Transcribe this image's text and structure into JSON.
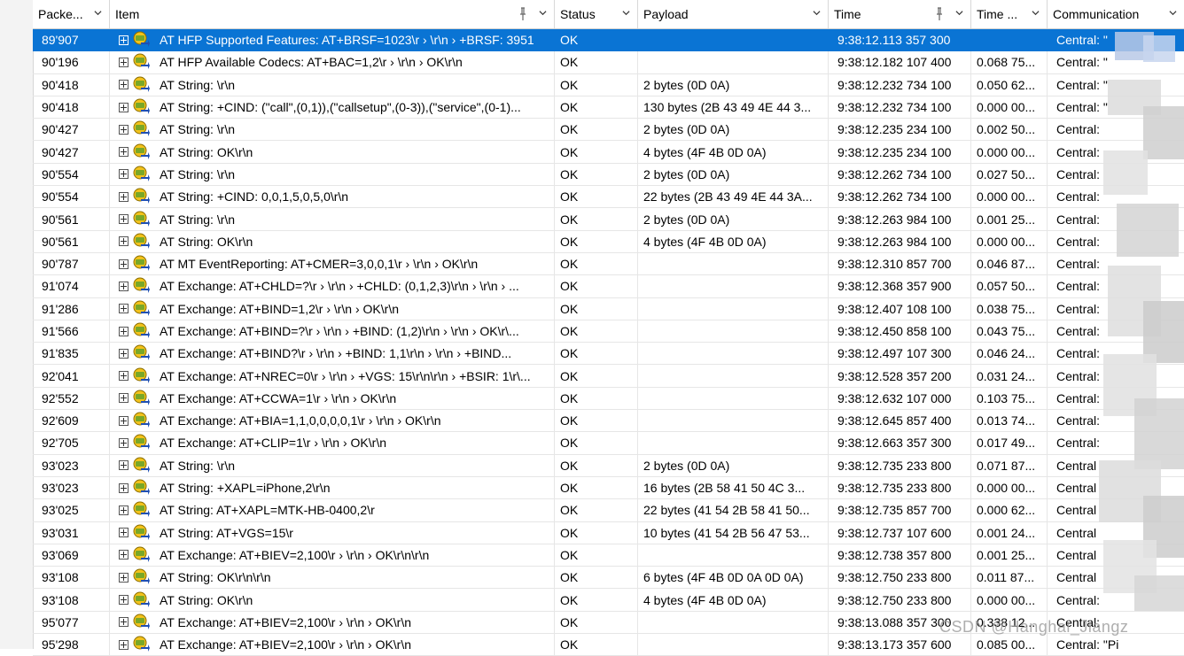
{
  "columns": {
    "packet": "Packe...",
    "item": "Item",
    "status": "Status",
    "payload": "Payload",
    "time": "Time",
    "delta": "Time ...",
    "comm": "Communication"
  },
  "rows": [
    {
      "packet": "89'907",
      "item": "AT HFP Supported Features: AT+BRSF=1023\\r › \\r\\n › +BRSF: 3951",
      "status": "OK",
      "payload": "",
      "time": "9:38:12.113 357 300",
      "delta": "",
      "comm": "Central: \"",
      "selected": true
    },
    {
      "packet": "90'196",
      "item": "AT HFP Available Codecs: AT+BAC=1,2\\r › \\r\\n › OK\\r\\n",
      "status": "OK",
      "payload": "",
      "time": "9:38:12.182 107 400",
      "delta": "0.068 75...",
      "comm": "Central: \""
    },
    {
      "packet": "90'418",
      "item": "AT String: \\r\\n",
      "status": "OK",
      "payload": "2 bytes (0D 0A)",
      "time": "9:38:12.232 734 100",
      "delta": "0.050 62...",
      "comm": "Central: \""
    },
    {
      "packet": "90'418",
      "item": "AT String: +CIND: (\"call\",(0,1)),(\"callsetup\",(0-3)),(\"service\",(0-1)...",
      "status": "OK",
      "payload": "130 bytes (2B 43 49 4E 44 3...",
      "time": "9:38:12.232 734 100",
      "delta": "0.000 00...",
      "comm": "Central: \""
    },
    {
      "packet": "90'427",
      "item": "AT String: \\r\\n",
      "status": "OK",
      "payload": "2 bytes (0D 0A)",
      "time": "9:38:12.235 234 100",
      "delta": "0.002 50...",
      "comm": "Central:"
    },
    {
      "packet": "90'427",
      "item": "AT String: OK\\r\\n",
      "status": "OK",
      "payload": "4 bytes (4F 4B 0D 0A)",
      "time": "9:38:12.235 234 100",
      "delta": "0.000 00...",
      "comm": "Central:"
    },
    {
      "packet": "90'554",
      "item": "AT String: \\r\\n",
      "status": "OK",
      "payload": "2 bytes (0D 0A)",
      "time": "9:38:12.262 734 100",
      "delta": "0.027 50...",
      "comm": "Central:"
    },
    {
      "packet": "90'554",
      "item": "AT String: +CIND: 0,0,1,5,0,5,0\\r\\n",
      "status": "OK",
      "payload": "22 bytes (2B 43 49 4E 44 3A...",
      "time": "9:38:12.262 734 100",
      "delta": "0.000 00...",
      "comm": "Central:"
    },
    {
      "packet": "90'561",
      "item": "AT String: \\r\\n",
      "status": "OK",
      "payload": "2 bytes (0D 0A)",
      "time": "9:38:12.263 984 100",
      "delta": "0.001 25...",
      "comm": "Central:"
    },
    {
      "packet": "90'561",
      "item": "AT String: OK\\r\\n",
      "status": "OK",
      "payload": "4 bytes (4F 4B 0D 0A)",
      "time": "9:38:12.263 984 100",
      "delta": "0.000 00...",
      "comm": "Central:"
    },
    {
      "packet": "90'787",
      "item": "AT MT EventReporting: AT+CMER=3,0,0,1\\r › \\r\\n › OK\\r\\n",
      "status": "OK",
      "payload": "",
      "time": "9:38:12.310 857 700",
      "delta": "0.046 87...",
      "comm": "Central:"
    },
    {
      "packet": "91'074",
      "item": "AT Exchange: AT+CHLD=?\\r › \\r\\n › +CHLD: (0,1,2,3)\\r\\n › \\r\\n › ...",
      "status": "OK",
      "payload": "",
      "time": "9:38:12.368 357 900",
      "delta": "0.057 50...",
      "comm": "Central:"
    },
    {
      "packet": "91'286",
      "item": "AT Exchange: AT+BIND=1,2\\r › \\r\\n › OK\\r\\n",
      "status": "OK",
      "payload": "",
      "time": "9:38:12.407 108 100",
      "delta": "0.038 75...",
      "comm": "Central:"
    },
    {
      "packet": "91'566",
      "item": "AT Exchange: AT+BIND=?\\r › \\r\\n › +BIND: (1,2)\\r\\n › \\r\\n › OK\\r\\...",
      "status": "OK",
      "payload": "",
      "time": "9:38:12.450 858 100",
      "delta": "0.043 75...",
      "comm": "Central:"
    },
    {
      "packet": "91'835",
      "item": "AT Exchange: AT+BIND?\\r › \\r\\n › +BIND: 1,1\\r\\n › \\r\\n › +BIND...",
      "status": "OK",
      "payload": "",
      "time": "9:38:12.497 107 300",
      "delta": "0.046 24...",
      "comm": "Central:"
    },
    {
      "packet": "92'041",
      "item": "AT Exchange: AT+NREC=0\\r › \\r\\n › +VGS: 15\\r\\n\\r\\n › +BSIR: 1\\r\\...",
      "status": "OK",
      "payload": "",
      "time": "9:38:12.528 357 200",
      "delta": "0.031 24...",
      "comm": "Central:"
    },
    {
      "packet": "92'552",
      "item": "AT Exchange: AT+CCWA=1\\r › \\r\\n › OK\\r\\n",
      "status": "OK",
      "payload": "",
      "time": "9:38:12.632 107 000",
      "delta": "0.103 75...",
      "comm": "Central:"
    },
    {
      "packet": "92'609",
      "item": "AT Exchange: AT+BIA=1,1,0,0,0,0,1\\r › \\r\\n › OK\\r\\n",
      "status": "OK",
      "payload": "",
      "time": "9:38:12.645 857 400",
      "delta": "0.013 74...",
      "comm": "Central:"
    },
    {
      "packet": "92'705",
      "item": "AT Exchange: AT+CLIP=1\\r › \\r\\n › OK\\r\\n",
      "status": "OK",
      "payload": "",
      "time": "9:38:12.663 357 300",
      "delta": "0.017 49...",
      "comm": "Central:"
    },
    {
      "packet": "93'023",
      "item": "AT String: \\r\\n",
      "status": "OK",
      "payload": "2 bytes (0D 0A)",
      "time": "9:38:12.735 233 800",
      "delta": "0.071 87...",
      "comm": "Central"
    },
    {
      "packet": "93'023",
      "item": "AT String: +XAPL=iPhone,2\\r\\n",
      "status": "OK",
      "payload": "16 bytes (2B 58 41 50 4C 3...",
      "time": "9:38:12.735 233 800",
      "delta": "0.000 00...",
      "comm": "Central"
    },
    {
      "packet": "93'025",
      "item": "AT String: AT+XAPL=MTK-HB-0400,2\\r",
      "status": "OK",
      "payload": "22 bytes (41 54 2B 58 41 50...",
      "time": "9:38:12.735 857 700",
      "delta": "0.000 62...",
      "comm": "Central"
    },
    {
      "packet": "93'031",
      "item": "AT String: AT+VGS=15\\r",
      "status": "OK",
      "payload": "10 bytes (41 54 2B 56 47 53...",
      "time": "9:38:12.737 107 600",
      "delta": "0.001 24...",
      "comm": "Central"
    },
    {
      "packet": "93'069",
      "item": "AT Exchange: AT+BIEV=2,100\\r › \\r\\n › OK\\r\\n\\r\\n",
      "status": "OK",
      "payload": "",
      "time": "9:38:12.738 357 800",
      "delta": "0.001 25...",
      "comm": "Central"
    },
    {
      "packet": "93'108",
      "item": "AT String: OK\\r\\n\\r\\n",
      "status": "OK",
      "payload": "6 bytes (4F 4B 0D 0A 0D 0A)",
      "time": "9:38:12.750 233 800",
      "delta": "0.011 87...",
      "comm": "Central"
    },
    {
      "packet": "93'108",
      "item": "AT String: OK\\r\\n",
      "status": "OK",
      "payload": "4 bytes (4F 4B 0D 0A)",
      "time": "9:38:12.750 233 800",
      "delta": "0.000 00...",
      "comm": "Central:"
    },
    {
      "packet": "95'077",
      "item": "AT Exchange: AT+BIEV=2,100\\r › \\r\\n › OK\\r\\n",
      "status": "OK",
      "payload": "",
      "time": "9:38:13.088 357 300",
      "delta": "0.338 12...",
      "comm": "Central:"
    },
    {
      "packet": "95'298",
      "item": "AT Exchange: AT+BIEV=2,100\\r › \\r\\n › OK\\r\\n",
      "status": "OK",
      "payload": "",
      "time": "9:38:13.173 357 600",
      "delta": "0.085 00...",
      "comm": "Central: \"Pi"
    }
  ],
  "watermark": "CSDN @Hanghai_Jiangz",
  "colors": {
    "selection": "#0a74d4",
    "gridline": "#e6e6e6",
    "header_border": "#d0d0d0"
  }
}
